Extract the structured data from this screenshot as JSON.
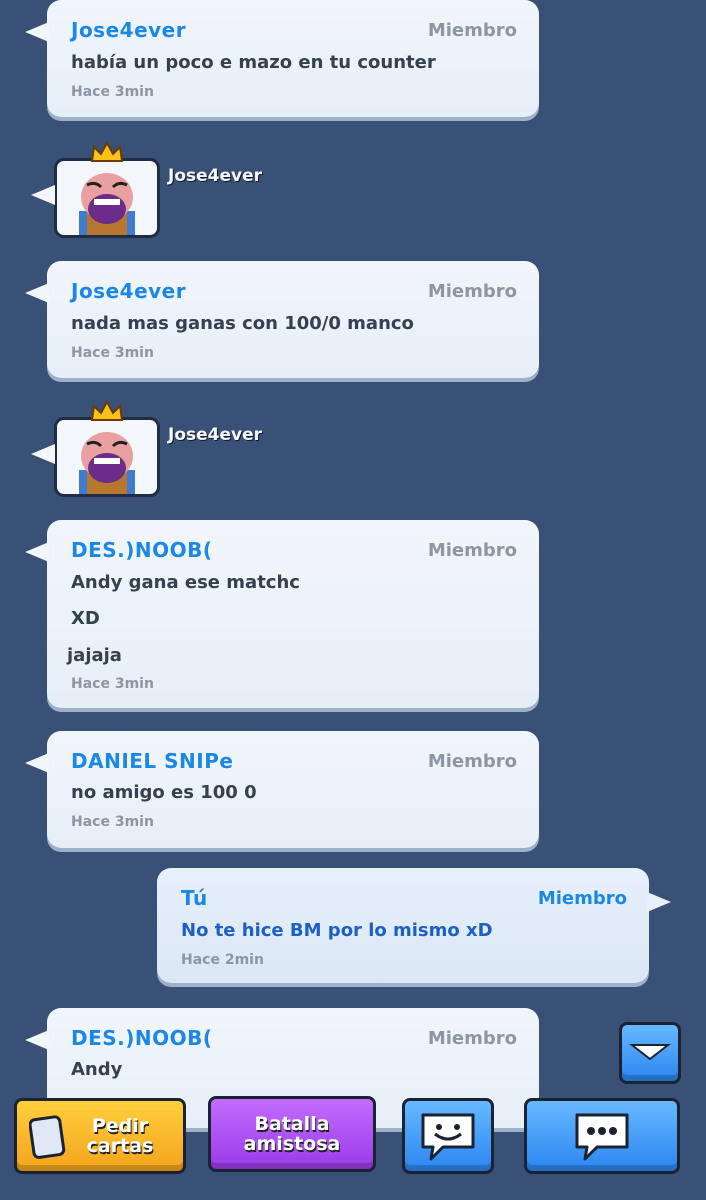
{
  "messages": [
    {
      "sender": "Jose4ever",
      "role": "Miembro",
      "lines": [
        "había un poco e mazo en tu counter"
      ],
      "time": "Hace 3min"
    },
    {
      "sender": "Jose4ever",
      "role": "Miembro",
      "lines": [
        "nada mas ganas con 100/0 manco"
      ],
      "time": "Hace 3min"
    },
    {
      "sender": "DES.)NOOB(",
      "role": "Miembro",
      "lines": [
        "Andy gana ese matchc",
        "XD",
        "jajaja"
      ],
      "time": "Hace 3min"
    },
    {
      "sender": "DANIEL SNIPe",
      "role": "Miembro",
      "lines": [
        "no amigo es 100 0"
      ],
      "time": "Hace 3min"
    },
    {
      "sender": "Tú",
      "role": "Miembro",
      "lines": [
        "No te hice BM por lo mismo xD"
      ],
      "time": "Hace 2min"
    },
    {
      "sender": "DES.)NOOB(",
      "role": "Miembro",
      "lines": [
        "Andy"
      ]
    }
  ],
  "emotes": [
    {
      "player": "Jose4ever",
      "emote": "laughing-king-icon"
    },
    {
      "player": "Jose4ever",
      "emote": "laughing-king-icon"
    }
  ],
  "toolbar": {
    "request_cards": "Pedir cartas",
    "friendly_battle": "Batalla amistosa",
    "emote_icon": "smile-bubble-icon",
    "chat_icon": "chat-bubble-icon"
  }
}
